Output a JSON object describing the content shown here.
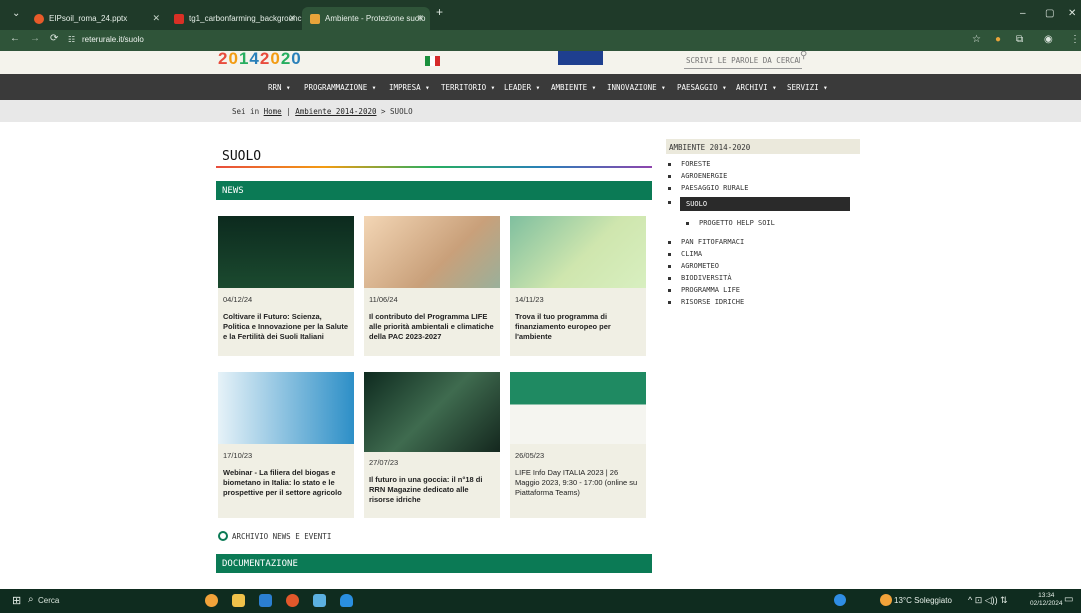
{
  "browser": {
    "tabs": [
      {
        "label": "EIPsoil_roma_24.pptx",
        "color": "#e85b2a"
      },
      {
        "label": "tg1_carbonfarming_backgrounc",
        "color": "#d93025"
      },
      {
        "label": "Ambiente - Protezione suolo",
        "color": "#e8a43a"
      }
    ],
    "url": "reterurale.it/suolo"
  },
  "header": {
    "logo_parts": [
      "2",
      "0",
      "1",
      "4",
      "2",
      "0",
      "2",
      "0"
    ],
    "search_placeholder": "SCRIVI LE PAROLE DA CERCARE"
  },
  "nav": [
    "RRN ▾",
    "PROGRAMMAZIONE ▾",
    "IMPRESA ▾",
    "TERRITORIO ▾",
    "LEADER ▾",
    "AMBIENTE ▾",
    "INNOVAZIONE ▾",
    "PAESAGGIO ▾",
    "ARCHIVI ▾",
    "SERVIZI ▾"
  ],
  "breadcrumb": {
    "prefix": "Sei in",
    "home": "Home",
    "sep1": "|",
    "section": "Ambiente 2014-2020",
    "sep2": ">",
    "current": "SUOLO"
  },
  "main": {
    "title": "SUOLO",
    "news_label": "NEWS",
    "archive_label": "ARCHIVIO NEWS E EVENTI",
    "doc_label": "DOCUMENTAZIONE",
    "cards": [
      {
        "date": "04/12/24",
        "title": "Coltivare il Futuro: Scienza, Politica e Innovazione per la Salute e la Fertilità dei Suoli Italiani"
      },
      {
        "date": "11/06/24",
        "title": "Il contributo del Programma LIFE alle priorità ambientali e climatiche della PAC 2023-2027"
      },
      {
        "date": "14/11/23",
        "title": "Trova il tuo programma di finanziamento europeo per l'ambiente"
      },
      {
        "date": "17/10/23",
        "title": "Webinar - La filiera del biogas e biometano in Italia: lo stato e le prospettive per il settore agricolo"
      },
      {
        "date": "27/07/23",
        "title": "Il futuro in una goccia: il n°18 di RRN Magazine dedicato alle risorse idriche"
      },
      {
        "date": "26/05/23",
        "title": "LIFE Info Day ITALIA 2023 | 26 Maggio 2023, 9:30 - 17:00 (online su Piattaforma Teams)"
      }
    ]
  },
  "sidebar": {
    "heading": "AMBIENTE 2014-2020",
    "items": [
      "FORESTE",
      "AGROENERGIE",
      "PAESAGGIO RURALE",
      "SUOLO",
      "PROGETTO HELP SOIL",
      "PAN FITOFARMACI",
      "CLIMA",
      "AGROMETEO",
      "BIODIVERSITÀ",
      "PROGRAMMA LIFE",
      "RISORSE IDRICHE"
    ]
  },
  "taskbar": {
    "search": "Cerca",
    "weather": "13°C Soleggiato",
    "time": "13:34",
    "date": "02/12/2024"
  }
}
